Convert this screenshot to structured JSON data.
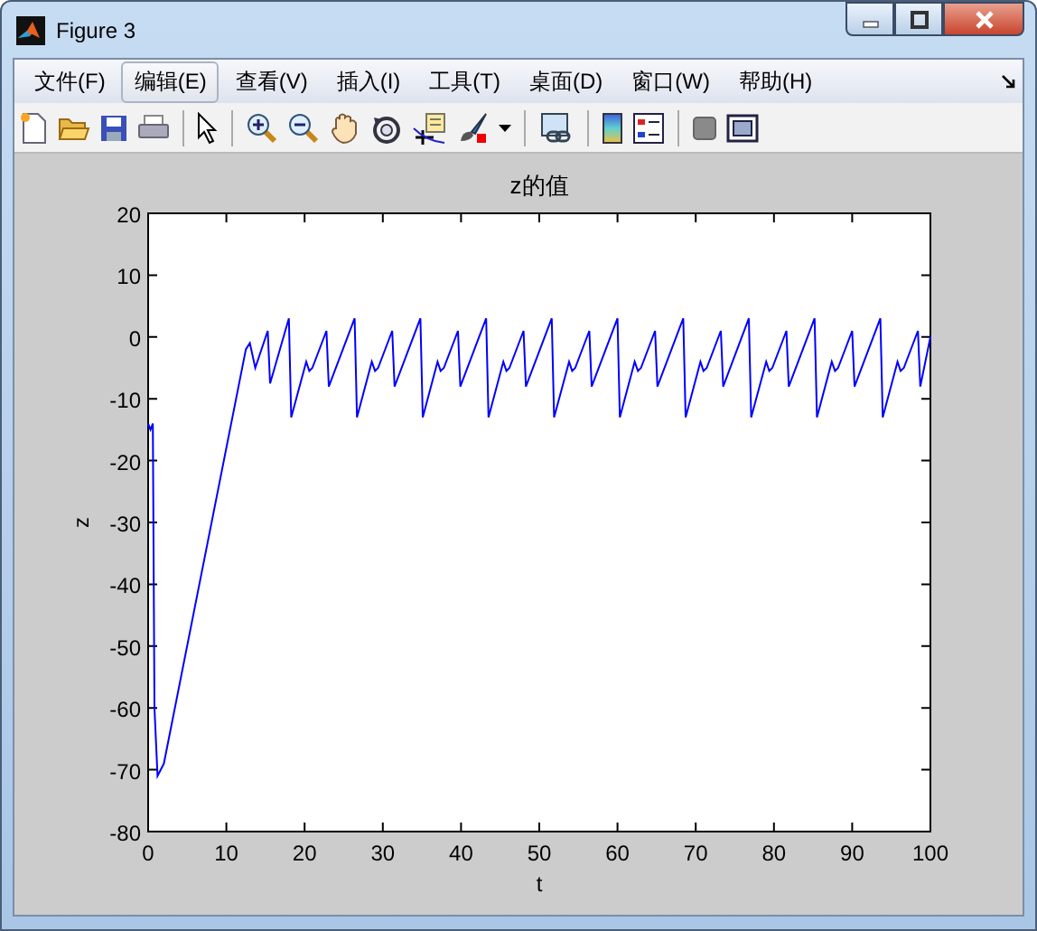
{
  "window": {
    "title": "Figure 3"
  },
  "menu": [
    {
      "label": "文件(F)",
      "selected": false
    },
    {
      "label": "编辑(E)",
      "selected": true
    },
    {
      "label": "查看(V)",
      "selected": false
    },
    {
      "label": "插入(I)",
      "selected": false
    },
    {
      "label": "工具(T)",
      "selected": false
    },
    {
      "label": "桌面(D)",
      "selected": false
    },
    {
      "label": "窗口(W)",
      "selected": false
    },
    {
      "label": "帮助(H)",
      "selected": false
    }
  ],
  "figure": {
    "chart_data": {
      "type": "line",
      "title": "z的值",
      "xlabel": "t",
      "ylabel": "z",
      "x": [
        0,
        0.3,
        0.6,
        0.8,
        1.2,
        2,
        12.5,
        13,
        13.7,
        15.3,
        15.6,
        18,
        18.3,
        20.2,
        20.6,
        21.0,
        22.8,
        23.1,
        26.4,
        26.7,
        28.6,
        29.0,
        29.4,
        31.2,
        31.5,
        34.8,
        35.1,
        37.0,
        37.4,
        37.8,
        39.6,
        39.9,
        43.2,
        43.5,
        45.4,
        45.8,
        46.2,
        48.0,
        48.3,
        51.6,
        51.9,
        53.8,
        54.2,
        54.6,
        56.4,
        56.7,
        60.0,
        60.3,
        62.2,
        62.6,
        63.0,
        64.8,
        65.1,
        68.4,
        68.7,
        70.6,
        71.0,
        71.4,
        73.2,
        73.5,
        76.8,
        77.1,
        79.0,
        79.4,
        79.8,
        81.6,
        81.9,
        85.2,
        85.5,
        87.4,
        87.8,
        88.2,
        90.0,
        90.3,
        93.6,
        93.9,
        95.8,
        96.2,
        96.6,
        98.4,
        98.7,
        100
      ],
      "series": [
        {
          "color": "#0000ff",
          "values": [
            -14,
            -15,
            -14,
            -60,
            -71,
            -69,
            -2,
            -1,
            -5,
            1,
            -7.5,
            3,
            -13,
            -4,
            -5.5,
            -5,
            1,
            -8,
            3,
            -13,
            -4,
            -5.5,
            -5,
            1,
            -8,
            3,
            -13,
            -4,
            -5.5,
            -5,
            1,
            -8,
            3,
            -13,
            -4,
            -5.5,
            -5,
            1,
            -8,
            3,
            -13,
            -4,
            -5.5,
            -5,
            1,
            -8,
            3,
            -13,
            -4,
            -5.5,
            -5,
            1,
            -8,
            3,
            -13,
            -4,
            -5.5,
            -5,
            1,
            -8,
            3,
            -13,
            -4,
            -5.5,
            -5,
            1,
            -8,
            3,
            -13,
            -4,
            -5.5,
            -5,
            1,
            -8,
            3,
            -13,
            -4,
            -5.5,
            -5,
            1,
            -8,
            0
          ]
        }
      ],
      "xlim": [
        0,
        100
      ],
      "ylim": [
        -80,
        20
      ],
      "xticks": [
        0,
        10,
        20,
        30,
        40,
        50,
        60,
        70,
        80,
        90,
        100
      ],
      "yticks": [
        -80,
        -70,
        -60,
        -50,
        -40,
        -30,
        -20,
        -10,
        0,
        10,
        20
      ]
    }
  }
}
